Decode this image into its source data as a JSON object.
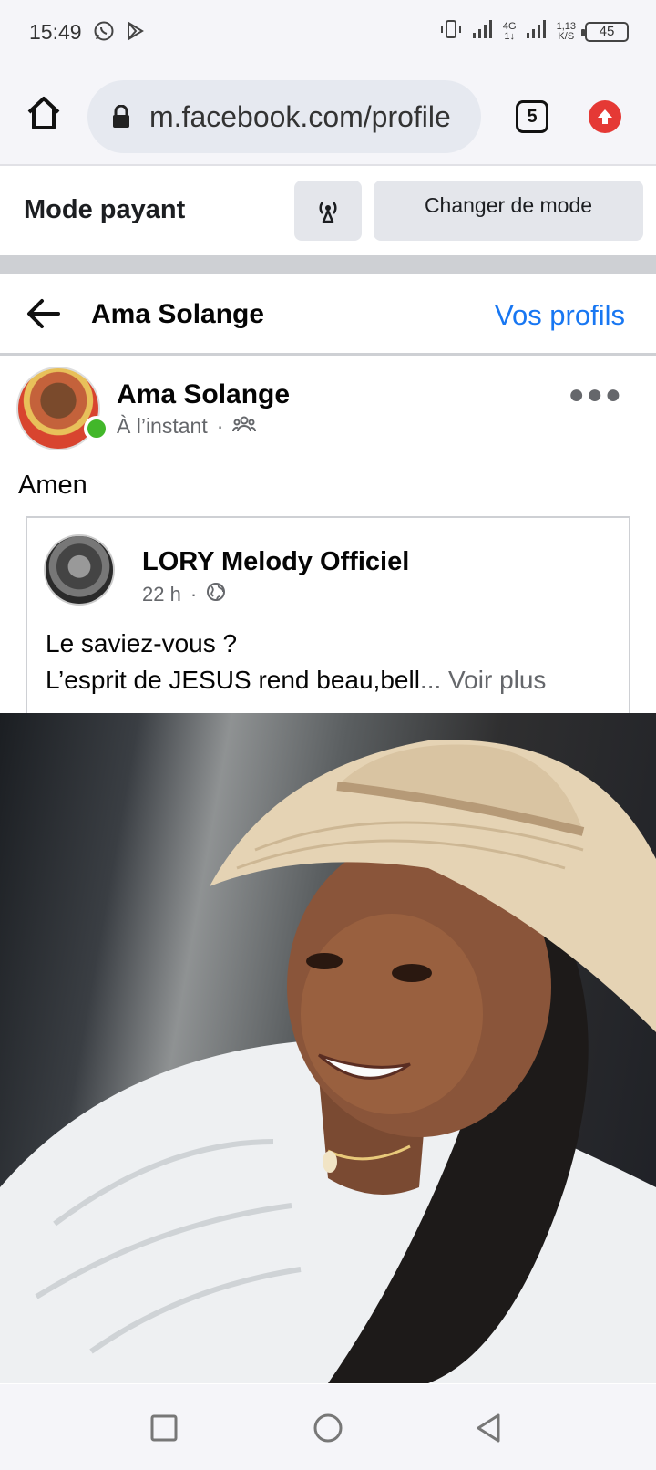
{
  "status_bar": {
    "time": "15:49",
    "network_type": "4G",
    "network_sub": "1↓",
    "data_speed": "1,13",
    "data_unit": "K/S",
    "battery": "45"
  },
  "browser": {
    "url": "m.facebook.com/profile",
    "tab_count": "5"
  },
  "mode_bar": {
    "title": "Mode payant",
    "change_button": "Changer de mode"
  },
  "header": {
    "title": "Ama Solange",
    "profiles_link": "Vos profils"
  },
  "post": {
    "author": "Ama Solange",
    "time": "À l’instant",
    "separator": "·",
    "text": "Amen",
    "shared": {
      "author": "LORY Melody Officiel",
      "time": "22 h",
      "separator": "·",
      "line1": "Le saviez-vous ?",
      "line2": "L’esprit de JESUS rend beau,bell",
      "see_more": "... Voir plus"
    }
  },
  "colors": {
    "accent": "#1877f2",
    "online": "#42b72a",
    "update": "#e53935"
  }
}
